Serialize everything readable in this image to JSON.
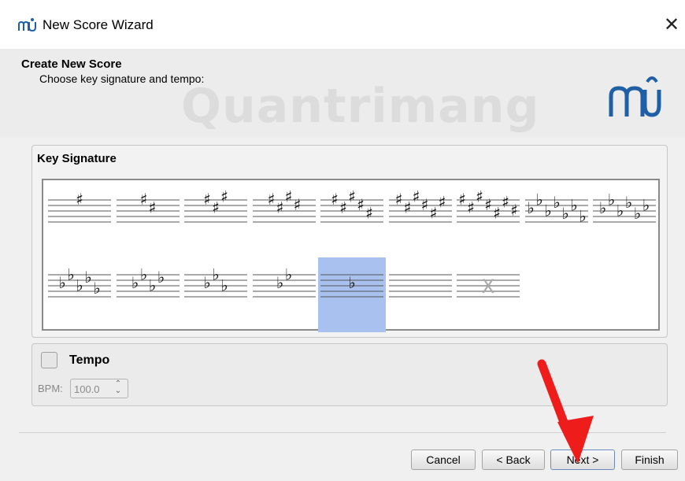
{
  "window": {
    "title": "New Score Wizard",
    "close_glyph": "✕"
  },
  "header": {
    "title": "Create New Score",
    "subtitle": "Choose key signature and tempo:",
    "watermark": "Quantrimang"
  },
  "key_signature": {
    "title": "Key Signature",
    "selected_index": 13,
    "keys": [
      {
        "accidental": "sharp",
        "count": 1
      },
      {
        "accidental": "sharp",
        "count": 2
      },
      {
        "accidental": "sharp",
        "count": 3
      },
      {
        "accidental": "sharp",
        "count": 4
      },
      {
        "accidental": "sharp",
        "count": 5
      },
      {
        "accidental": "sharp",
        "count": 6
      },
      {
        "accidental": "sharp",
        "count": 7
      },
      {
        "accidental": "flat",
        "count": 7
      },
      {
        "accidental": "flat",
        "count": 6
      },
      {
        "accidental": "flat",
        "count": 5
      },
      {
        "accidental": "flat",
        "count": 4
      },
      {
        "accidental": "flat",
        "count": 3
      },
      {
        "accidental": "flat",
        "count": 2
      },
      {
        "accidental": "flat",
        "count": 1
      },
      {
        "accidental": "none",
        "count": 0
      },
      {
        "accidental": "atonal",
        "count": 0
      }
    ]
  },
  "tempo": {
    "label": "Tempo",
    "checked": false,
    "bpm_label": "BPM:",
    "bpm_value": "100.0"
  },
  "buttons": {
    "cancel": "Cancel",
    "back": "< Back",
    "next": "Next >",
    "finish": "Finish"
  },
  "colors": {
    "selected": "#a9c1ee",
    "logo": "#1f5fa6",
    "arrow": "#ef1c1c"
  },
  "icons": {
    "app": "musescore-icon",
    "logo": "musescore-logo",
    "close": "close-icon",
    "spin": "spinbox-arrows-icon"
  }
}
